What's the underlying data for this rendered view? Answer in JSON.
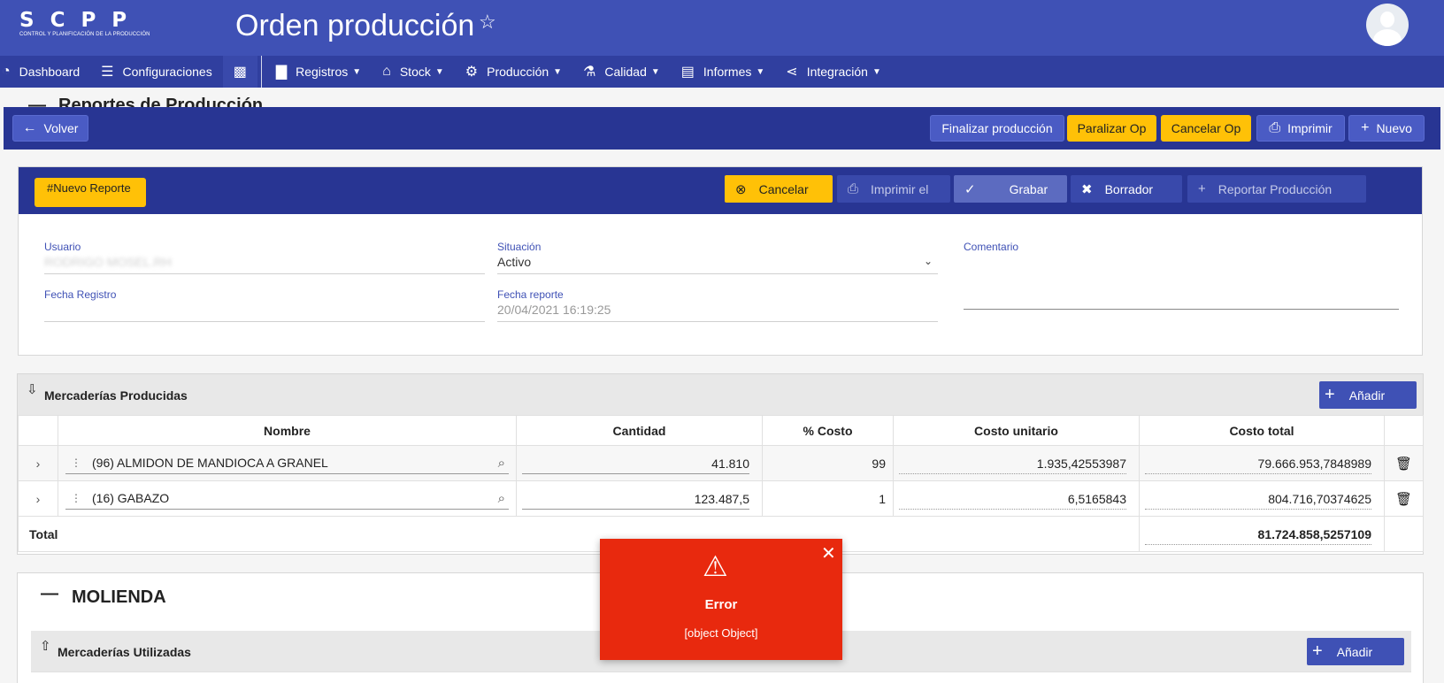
{
  "header": {
    "logo_letters": "SCPP",
    "logo_sub": "CONTROL Y PLANIFICACIÓN DE LA PRODUCCIÓN",
    "title": "Orden producción",
    "star_icon": "star-outline-icon",
    "avatar_icon": "user-avatar-icon"
  },
  "nav": {
    "items": [
      {
        "label": "Dashboard",
        "icon": "speedometer-icon"
      },
      {
        "label": "Configuraciones",
        "icon": "sliders-icon"
      },
      {
        "label": "",
        "icon": "boxes-icon"
      },
      {
        "label": "Registros",
        "icon": "book-icon"
      },
      {
        "label": "Stock",
        "icon": "warehouse-icon"
      },
      {
        "label": "Producción",
        "icon": "gear-icon"
      },
      {
        "label": "Calidad",
        "icon": "flask-icon"
      },
      {
        "label": "Informes",
        "icon": "document-icon"
      },
      {
        "label": "Integración",
        "icon": "share-icon"
      }
    ]
  },
  "peek_title": "Reportes de Producción",
  "actionbar": {
    "back": "Volver",
    "finalize": "Finalizar producción",
    "pause": "Paralizar Op",
    "cancel": "Cancelar Op",
    "print": "Imprimir",
    "new": "Nuevo"
  },
  "report": {
    "tag": "#Nuevo Reporte",
    "buttons": {
      "cancel": "Cancelar",
      "print": "Imprimir el",
      "save": "Grabar",
      "draft": "Borrador",
      "report": "Reportar Producción"
    },
    "fields": {
      "usuario_label": "Usuario",
      "usuario_value": "RODRIGO MOSEL.RH",
      "situacion_label": "Situación",
      "situacion_value": "Activo",
      "comentario_label": "Comentario",
      "fecha_registro_label": "Fecha Registro",
      "fecha_reporte_label": "Fecha reporte",
      "fecha_reporte_value": "20/04/2021 16:19:25"
    }
  },
  "producidas": {
    "title": "Mercaderías Producidas",
    "add": "Añadir",
    "columns": [
      "Nombre",
      "Cantidad",
      "% Costo",
      "Costo unitario",
      "Costo total"
    ],
    "rows": [
      {
        "nombre": "(96) ALMIDON DE MANDIOCA A GRANEL",
        "cantidad": "41.810",
        "costo_pct": "99",
        "costo_unit": "1.935,42553987",
        "costo_total": "79.666.953,7848989"
      },
      {
        "nombre": "(16) GABAZO",
        "cantidad": "123.487,5",
        "costo_pct": "1",
        "costo_unit": "6,5165843",
        "costo_total": "804.716,70374625"
      }
    ],
    "total_label": "Total",
    "total_value": "81.724.858,5257109"
  },
  "molienda": {
    "title": "MOLIENDA",
    "utilizadas_title": "Mercaderías Utilizadas",
    "add": "Añadir"
  },
  "toast": {
    "title": "Error",
    "message": "[object Object]"
  }
}
